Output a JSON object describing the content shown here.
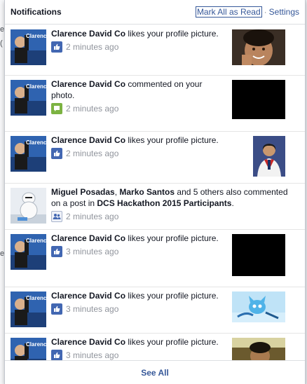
{
  "header": {
    "title": "Notifications",
    "mark_all": "Mark All as Read",
    "separator": "·",
    "settings": "Settings"
  },
  "notifications": [
    {
      "actor": "Clarence David Co",
      "action": " likes your profile picture.",
      "time": "2 minutes ago",
      "icon": "like-icon",
      "thumb": "boy-portrait"
    },
    {
      "actor": "Clarence David Co",
      "action": " commented on your photo.",
      "time": "2 minutes ago",
      "icon": "comment-icon",
      "thumb": "black-image"
    },
    {
      "actor": "Clarence David Co",
      "action": " likes your profile picture.",
      "time": "2 minutes ago",
      "icon": "like-icon",
      "thumb": "graduation-portrait"
    },
    {
      "actor": "Miguel Posadas",
      "separator": ", ",
      "actor2": "Marko Santos",
      "action": " and 5 others also commented on a post in ",
      "target": "DCS Hackathon 2015 Participants",
      "end": ".",
      "time": "2 minutes ago",
      "icon": "group-icon"
    },
    {
      "actor": "Clarence David Co",
      "action": " likes your profile picture.",
      "time": "3 minutes ago",
      "icon": "like-icon",
      "thumb": "black-image"
    },
    {
      "actor": "Clarence David Co",
      "action": " likes your profile picture.",
      "time": "3 minutes ago",
      "icon": "like-icon",
      "thumb": "anime-cat-image"
    },
    {
      "actor": "Clarence David Co",
      "action": " likes your profile picture.",
      "time": "3 minutes ago",
      "icon": "like-icon",
      "thumb": "photo-image"
    }
  ],
  "avatar_text": "Clarence",
  "footer": {
    "see_all": "See All"
  },
  "colors": {
    "link": "#365899",
    "like": "#4267b2",
    "comment": "#7cb342",
    "muted": "#90949c"
  }
}
